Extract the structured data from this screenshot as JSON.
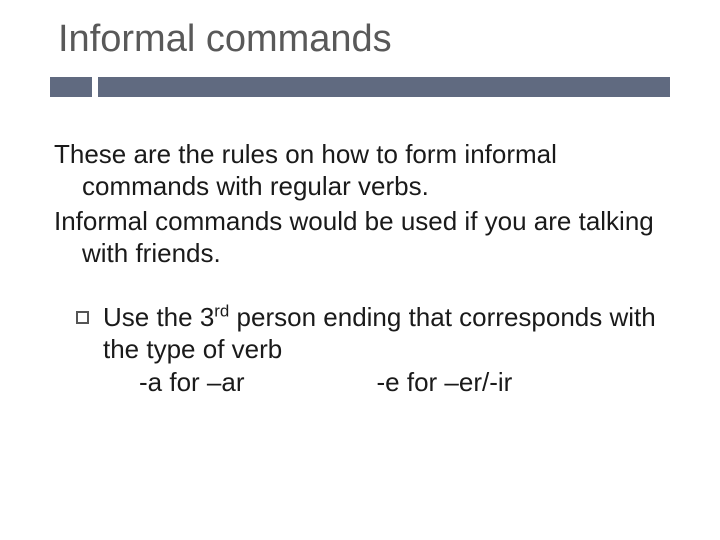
{
  "title": "Informal commands",
  "intro": {
    "line1": "These are the rules on how to form informal commands with regular verbs.",
    "line2": "Informal commands would be used if you are talking with friends."
  },
  "bullet": {
    "text_pre": "Use the 3",
    "ord": "rd",
    "text_post": " person ending that corresponds with the type of verb",
    "example_a": "-a for –ar",
    "example_b": "-e for –er/-ir"
  }
}
